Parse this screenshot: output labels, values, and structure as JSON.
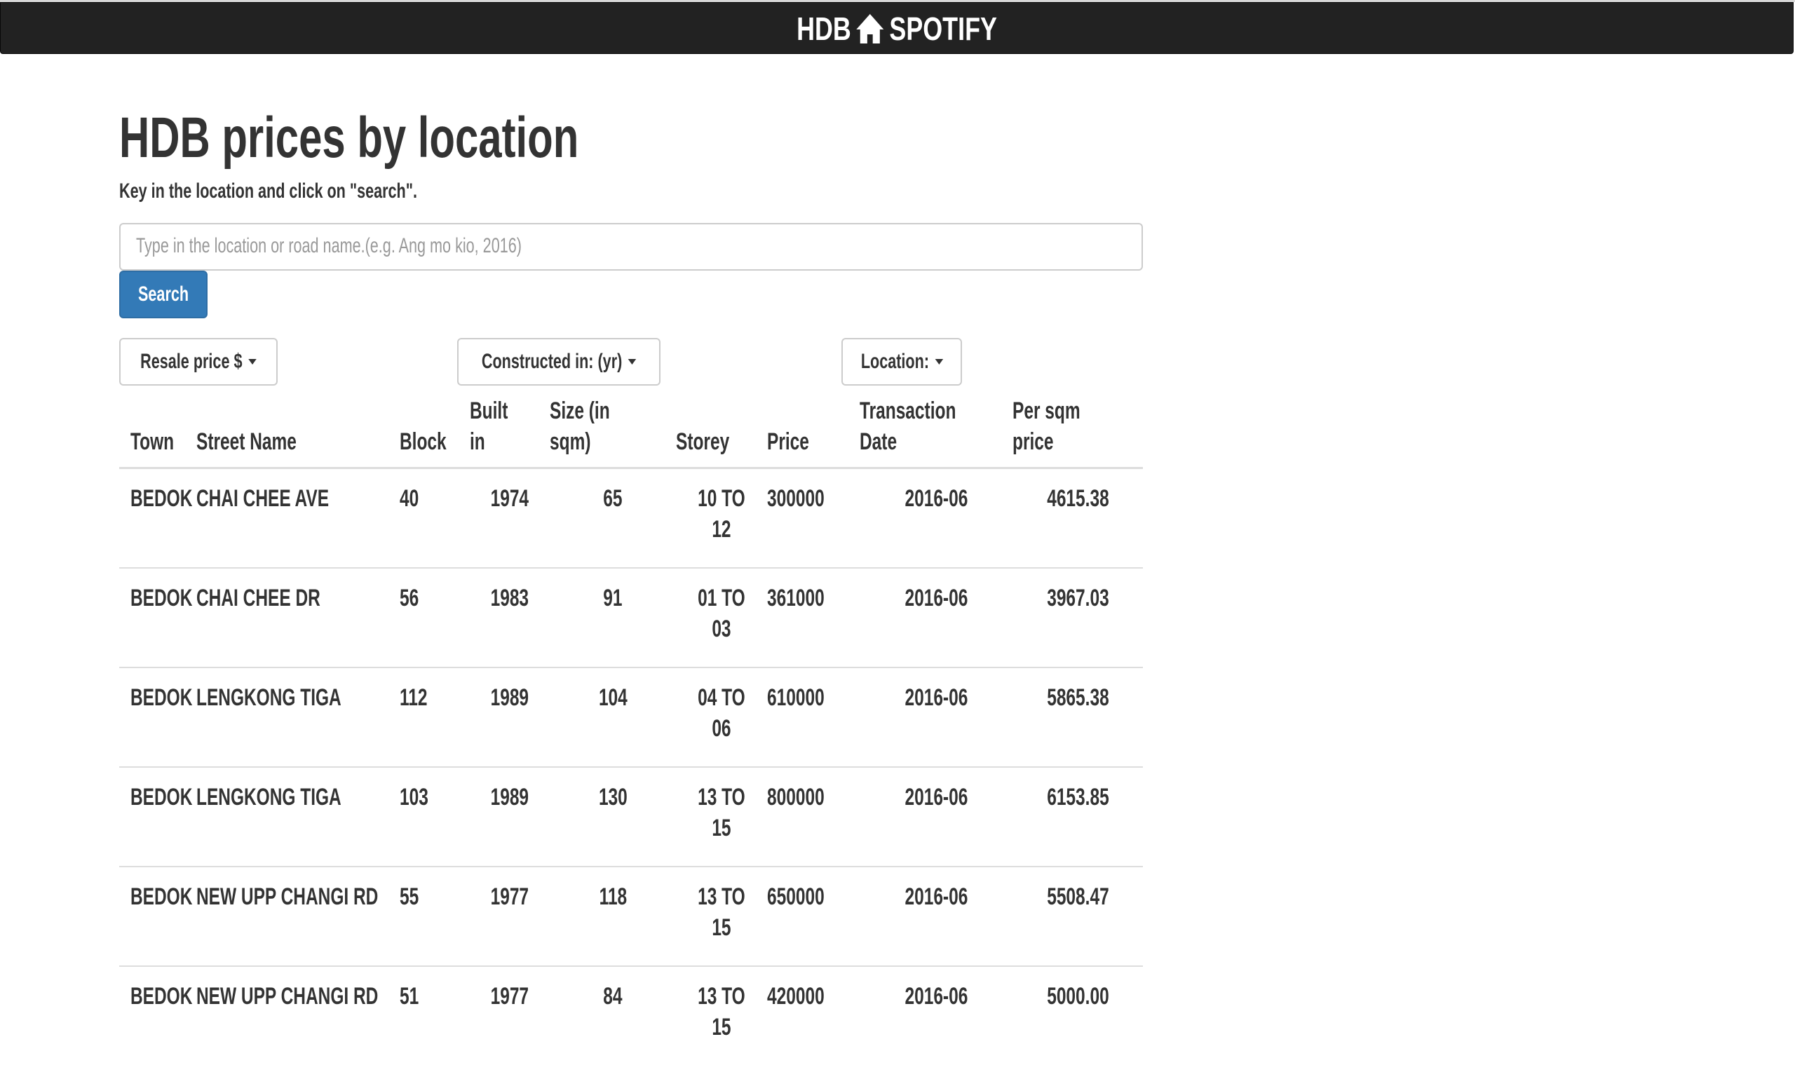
{
  "navbar": {
    "brand_left": "HDB",
    "brand_icon": "home-icon",
    "brand_right": "SPOTIFY"
  },
  "page": {
    "title": "HDB prices by location",
    "instructions": "Key in the location and click on \"search\"."
  },
  "search": {
    "placeholder": "Type in the location or road name.(e.g. Ang mo kio, 2016)",
    "value": "",
    "button_label": "Search"
  },
  "filters": {
    "price": "Resale price $",
    "constructed": "Constructed in: (yr)",
    "location": "Location:"
  },
  "table": {
    "headers": {
      "town": "Town",
      "street": "Street Name",
      "block": "Block",
      "built_1": "Built",
      "built_2": "in",
      "size_1": "Size (in",
      "size_2": "sqm)",
      "storey": "Storey",
      "price": "Price",
      "date_1": "Transaction",
      "date_2": "Date",
      "psqm_1": "Per sqm",
      "psqm_2": "price"
    },
    "rows": [
      {
        "town": "BEDOK",
        "street": "CHAI CHEE AVE",
        "block": "40",
        "built": "1974",
        "size": "65",
        "storey_1": "10 TO",
        "storey_2": "12",
        "price": "300000",
        "date": "2016-06",
        "psqm": "4615.38"
      },
      {
        "town": "BEDOK",
        "street": "CHAI CHEE DR",
        "block": "56",
        "built": "1983",
        "size": "91",
        "storey_1": "01 TO",
        "storey_2": "03",
        "price": "361000",
        "date": "2016-06",
        "psqm": "3967.03"
      },
      {
        "town": "BEDOK",
        "street": "LENGKONG TIGA",
        "block": "112",
        "built": "1989",
        "size": "104",
        "storey_1": "04 TO",
        "storey_2": "06",
        "price": "610000",
        "date": "2016-06",
        "psqm": "5865.38"
      },
      {
        "town": "BEDOK",
        "street": "LENGKONG TIGA",
        "block": "103",
        "built": "1989",
        "size": "130",
        "storey_1": "13 TO",
        "storey_2": "15",
        "price": "800000",
        "date": "2016-06",
        "psqm": "6153.85"
      },
      {
        "town": "BEDOK",
        "street": "NEW UPP CHANGI RD",
        "block": "55",
        "built": "1977",
        "size": "118",
        "storey_1": "13 TO",
        "storey_2": "15",
        "price": "650000",
        "date": "2016-06",
        "psqm": "5508.47"
      },
      {
        "town": "BEDOK",
        "street": "NEW UPP CHANGI RD",
        "block": "51",
        "built": "1977",
        "size": "84",
        "storey_1": "13 TO",
        "storey_2": "15",
        "price": "420000",
        "date": "2016-06",
        "psqm": "5000.00"
      }
    ]
  }
}
